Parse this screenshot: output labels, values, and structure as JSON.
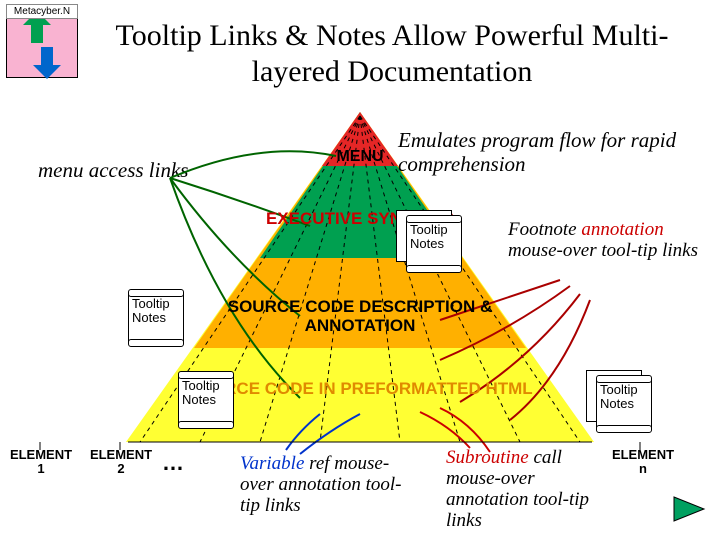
{
  "logo_text": "Metacyber.N",
  "title": "Tooltip Links & Notes Allow Powerful Multi-layered Documentation",
  "subtitle": "menu access links",
  "tagline": "Emulates program flow for rapid comprehension",
  "band_labels": {
    "menu": "MENU",
    "exec": "EXECUTIVE SYNOPSIS",
    "src_desc": "SOURCE CODE DESCRIPTION & ANNOTATION",
    "src_html": "SOURCE CODE IN PREFORMATTED HTML"
  },
  "tooltip_note": "Tooltip Notes",
  "annotations": {
    "footnote": "Footnote annotation mouse-over tool-tip links",
    "variable": "Variable ref mouse-over annotation tool-tip links",
    "subroutine": "Subroutine call mouse-over annotation tool-tip links"
  },
  "elements": {
    "e1": "ELEMENT 1",
    "e2": "ELEMENT 2",
    "dots": "…",
    "en": "ELEMENT n"
  },
  "annotation_span": "annotation",
  "variable_span": "Variable",
  "subroutine_span": "Subroutine",
  "colors": {
    "red": "#e52626",
    "green": "#00a050",
    "orange": "#ffb000",
    "yellow": "#ffff33",
    "pink": "#f9b3d1",
    "darkgreen": "#006400",
    "darkred": "#990000",
    "blue": "#0033cc"
  }
}
